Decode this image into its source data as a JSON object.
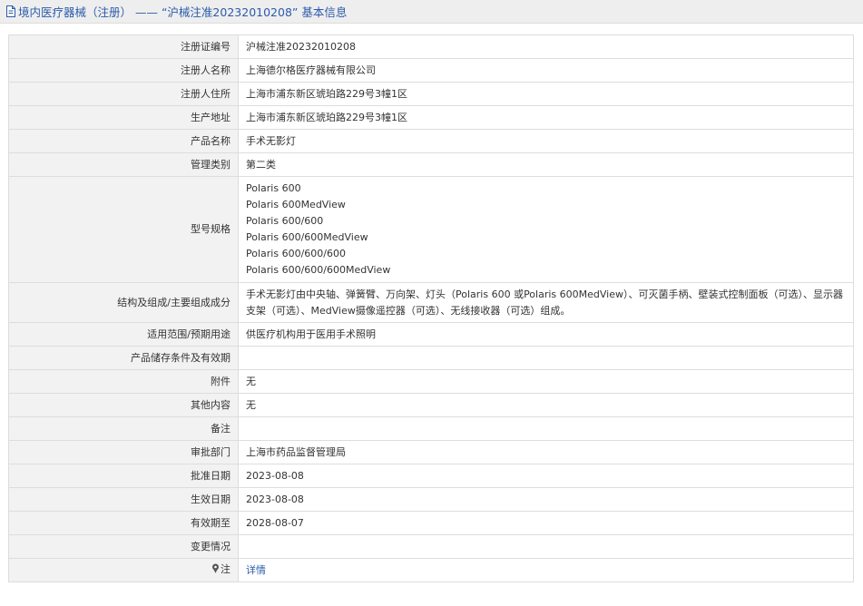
{
  "header": {
    "title": "境内医疗器械（注册） —— “沪械注准20232010208” 基本信息",
    "icon": "document-icon",
    "color": "#2b5bab"
  },
  "rows": {
    "reg_no": {
      "label": "注册证编号",
      "value": "沪械注准20232010208"
    },
    "registrant": {
      "label": "注册人名称",
      "value": "上海德尔格医疗器械有限公司"
    },
    "address": {
      "label": "注册人住所",
      "value": "上海市浦东新区琥珀路229号3幢1区"
    },
    "production": {
      "label": "生产地址",
      "value": "上海市浦东新区琥珀路229号3幢1区"
    },
    "product": {
      "label": "产品名称",
      "value": "手术无影灯"
    },
    "category": {
      "label": "管理类别",
      "value": "第二类"
    },
    "model": {
      "label": "型号规格",
      "values": [
        "Polaris 600",
        "Polaris 600MedView",
        "Polaris 600/600",
        "Polaris 600/600MedView",
        "Polaris 600/600/600",
        "Polaris 600/600/600MedView"
      ]
    },
    "structure": {
      "label": "结构及组成/主要组成成分",
      "value": "手术无影灯由中央轴、弹簧臂、万向架、灯头（Polaris 600 或Polaris 600MedView）、可灭菌手柄、壁装式控制面板（可选）、显示器支架（可选）、MedView摄像遥控器（可选）、无线接收器（可选）组成。"
    },
    "usage": {
      "label": "适用范围/预期用途",
      "value": "供医疗机构用于医用手术照明"
    },
    "storage": {
      "label": "产品储存条件及有效期",
      "value": ""
    },
    "attachment": {
      "label": "附件",
      "value": "无"
    },
    "other": {
      "label": "其他内容",
      "value": "无"
    },
    "remark": {
      "label": "备注",
      "value": ""
    },
    "dept": {
      "label": "审批部门",
      "value": "上海市药品监督管理局"
    },
    "approve_date": {
      "label": "批准日期",
      "value": "2023-08-08"
    },
    "effective_date": {
      "label": "生效日期",
      "value": "2023-08-08"
    },
    "expiry": {
      "label": "有效期至",
      "value": "2028-08-07"
    },
    "change": {
      "label": "变更情况",
      "value": ""
    },
    "note": {
      "label": "注",
      "value": "详情",
      "icon": "pin-icon"
    }
  }
}
